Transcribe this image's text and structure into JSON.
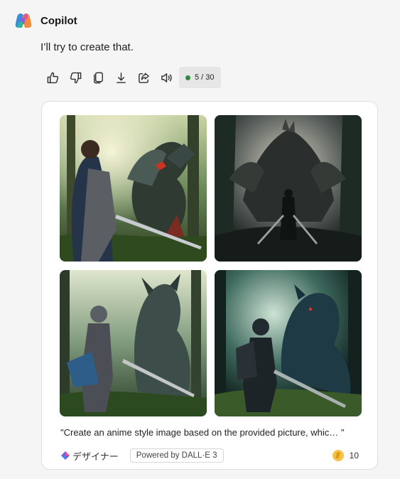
{
  "header": {
    "name": "Copilot"
  },
  "message": {
    "text": "I’ll try to create that."
  },
  "actions": {
    "icons": [
      "thumbs-up-icon",
      "thumbs-down-icon",
      "copy-icon",
      "download-icon",
      "share-icon",
      "speaker-icon"
    ],
    "counter": "5 / 30",
    "counter_dot_color": "#2f8a3e"
  },
  "card": {
    "images": [
      {
        "name": "knight-with-blue-cape-and-red-eyed-dragon"
      },
      {
        "name": "dark-knight-silhouette-before-giant-dragon"
      },
      {
        "name": "armored-knight-facing-horned-dragon"
      },
      {
        "name": "knight-with-sword-and-shadow-dragon"
      }
    ],
    "prompt": "\"Create an anime style image based on the provided picture, whic… \"",
    "designer_label": "デザイナー",
    "powered_by": "Powered by DALL·E 3",
    "boosts": "10"
  }
}
